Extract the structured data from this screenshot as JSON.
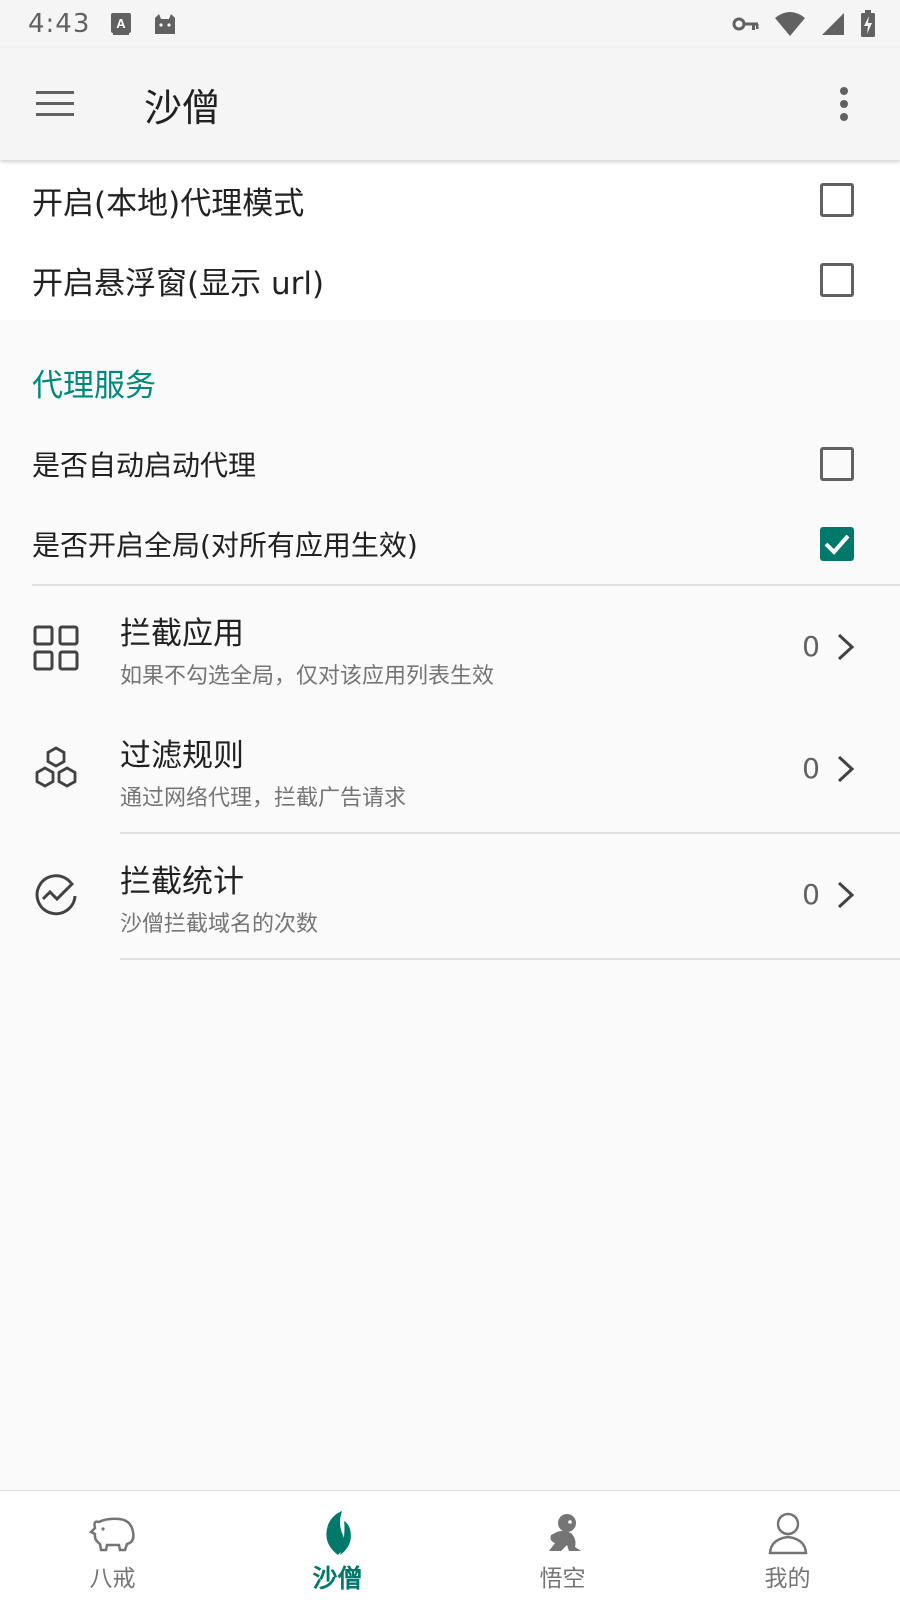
{
  "status": {
    "time": "4:43"
  },
  "app_bar": {
    "title": "沙僧"
  },
  "toggles": [
    {
      "label": "开启(本地)代理模式",
      "checked": false
    },
    {
      "label": "开启悬浮窗(显示 url)",
      "checked": false
    }
  ],
  "proxy_section": {
    "header": "代理服务",
    "options": [
      {
        "label": "是否自动启动代理",
        "checked": false
      },
      {
        "label": "是否开启全局(对所有应用生效)",
        "checked": true
      }
    ],
    "items": [
      {
        "title": "拦截应用",
        "subtitle": "如果不勾选全局，仅对该应用列表生效",
        "count": "0",
        "icon": "grid-icon"
      },
      {
        "title": "过滤规则",
        "subtitle": "通过网络代理，拦截广告请求",
        "count": "0",
        "icon": "hexagons-icon"
      },
      {
        "title": "拦截统计",
        "subtitle": "沙僧拦截域名的次数",
        "count": "0",
        "icon": "chart-icon"
      }
    ]
  },
  "bottom_nav": {
    "tabs": [
      {
        "label": "八戒",
        "icon": "pig-icon",
        "active": false
      },
      {
        "label": "沙僧",
        "icon": "leaf-icon",
        "active": true
      },
      {
        "label": "悟空",
        "icon": "monkey-icon",
        "active": false
      },
      {
        "label": "我的",
        "icon": "person-icon",
        "active": false
      }
    ]
  },
  "colors": {
    "accent": "#00796b",
    "section_header": "#00897b"
  }
}
